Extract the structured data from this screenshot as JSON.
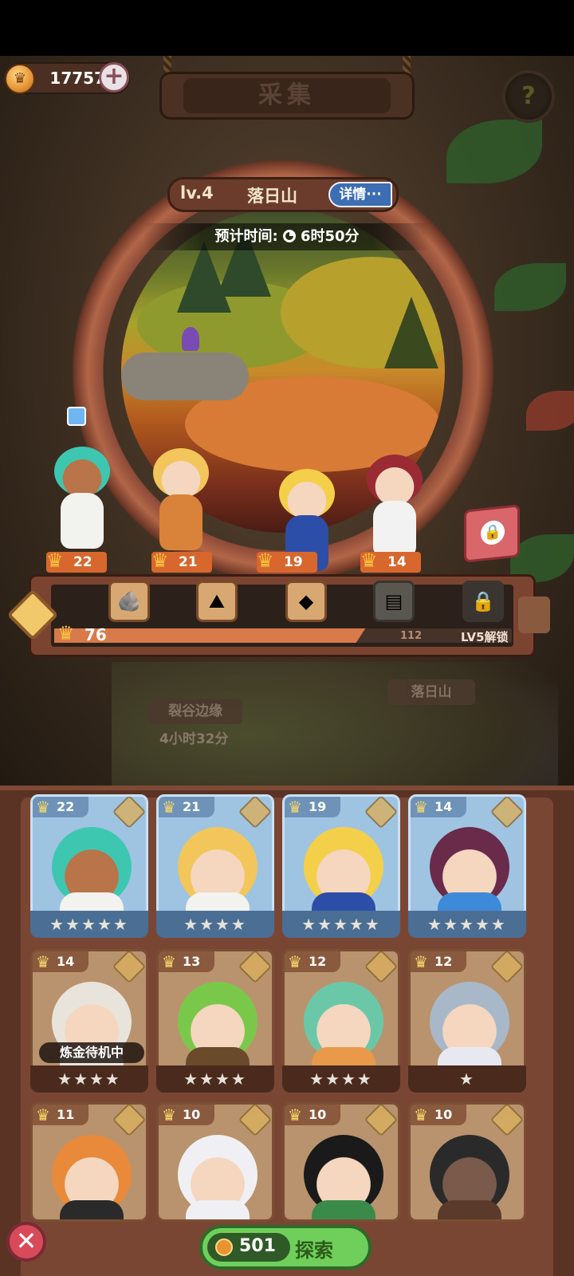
{
  "currency": {
    "amount": "17757",
    "plus": "+"
  },
  "header": {
    "title": "采集",
    "help": "?"
  },
  "location": {
    "level": "lv.4",
    "name": "落日山",
    "detail_button": "详情···",
    "eta_label": "预计时间:",
    "eta_value": "6时50分"
  },
  "team": [
    {
      "level": "22",
      "hair": "#3ec7b0",
      "skin": "#b9744a",
      "cloth": "#f2f2ee"
    },
    {
      "level": "21",
      "hair": "#f2c65a",
      "skin": "#f5d6bf",
      "cloth": "#d8823a"
    },
    {
      "level": "19",
      "hair": "#f4cf4a",
      "skin": "#f5d6bf",
      "cloth": "#2d4ea8"
    },
    {
      "level": "14",
      "hair": "#9a2a34",
      "skin": "#f5d6bf",
      "cloth": "#f2f2f2"
    }
  ],
  "loot": {
    "items": [
      "ore",
      "sand",
      "copper",
      "stone",
      "lock"
    ],
    "progress_value": "76",
    "progress_max": "112",
    "progress_fraction": 0.68,
    "unlock_note": "LV5解锁"
  },
  "map": {
    "other_location": "裂谷边缘",
    "other_time": "4小时32分",
    "current_location": "落日山"
  },
  "roster": [
    {
      "level": "22",
      "stars": "★★★★★",
      "style": "blue",
      "hair": "#3ec7b0",
      "skin": "#b9744a",
      "cloth": "#f2f2ee"
    },
    {
      "level": "21",
      "stars": "★★★★",
      "style": "blue",
      "hair": "#f2c65a",
      "skin": "#f5d6bf",
      "cloth": "#f2f2ee"
    },
    {
      "level": "19",
      "stars": "★★★★★",
      "style": "blue",
      "hair": "#f4cf4a",
      "skin": "#f5d6bf",
      "cloth": "#2d4ea8"
    },
    {
      "level": "14",
      "stars": "★★★★★",
      "style": "blue",
      "hair": "#6a2a4a",
      "skin": "#f5d6bf",
      "cloth": "#3d8ad8"
    },
    {
      "level": "14",
      "stars": "★★★★",
      "style": "brown",
      "hair": "#e8e4dc",
      "skin": "#f5d6bf",
      "cloth": "#e8e4dc",
      "status": "炼金待机中"
    },
    {
      "level": "13",
      "stars": "★★★★",
      "style": "brown",
      "hair": "#7ac84a",
      "skin": "#f5d6bf",
      "cloth": "#6a4a2a"
    },
    {
      "level": "12",
      "stars": "★★★★",
      "style": "brown",
      "hair": "#6ac8a8",
      "skin": "#f5d6bf",
      "cloth": "#e89a4a"
    },
    {
      "level": "12",
      "stars": "★",
      "style": "brown",
      "hair": "#a8b8c8",
      "skin": "#f5d6bf",
      "cloth": "#e8e8f0"
    },
    {
      "level": "11",
      "stars": "",
      "style": "brown",
      "hair": "#e88a3a",
      "skin": "#f5d6bf",
      "cloth": "#2a2a2a"
    },
    {
      "level": "10",
      "stars": "",
      "style": "brown",
      "hair": "#f0f0f4",
      "skin": "#f5d6bf",
      "cloth": "#f0f0f4"
    },
    {
      "level": "10",
      "stars": "",
      "style": "brown",
      "hair": "#1a1a1a",
      "skin": "#f5d6bf",
      "cloth": "#3a8a4a"
    },
    {
      "level": "10",
      "stars": "",
      "style": "brown",
      "hair": "#2a2a2a",
      "skin": "#7a5a4a",
      "cloth": "#5a3a2a"
    }
  ],
  "footer": {
    "close": "✕",
    "explore_cost": "501",
    "explore_label": "探索"
  }
}
